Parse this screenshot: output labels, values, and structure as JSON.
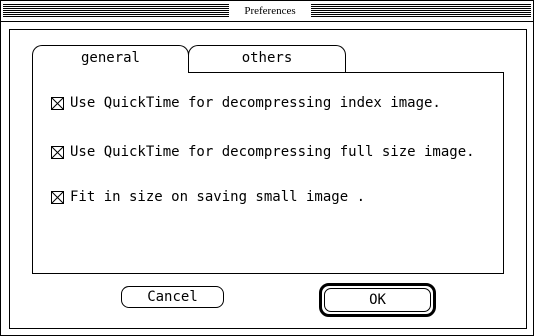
{
  "window": {
    "title": "Preferences"
  },
  "tabs": [
    {
      "label": "general",
      "selected": true
    },
    {
      "label": "others",
      "selected": false
    }
  ],
  "options": [
    {
      "label": "Use QuickTime for decompressing index image.",
      "checked": true
    },
    {
      "label": "Use QuickTime for decompressing full size image.",
      "checked": true
    },
    {
      "label": "Fit in size on saving small image .",
      "checked": true
    }
  ],
  "buttons": {
    "cancel": "Cancel",
    "ok": "OK"
  }
}
